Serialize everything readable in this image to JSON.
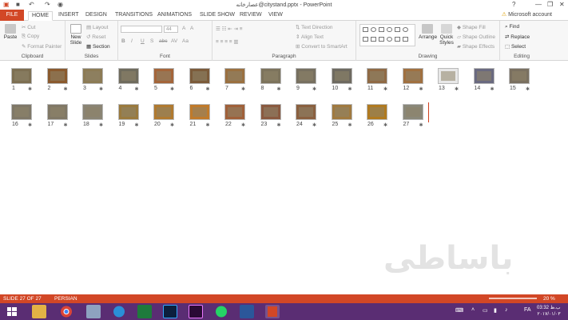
{
  "window": {
    "title": "عصارخانه@citystand.pptx - PowerPoint",
    "help": "?",
    "min": "—",
    "restore": "❐",
    "close": "✕"
  },
  "quick_access": {
    "save": "■",
    "undo": "↶",
    "redo": "↷",
    "start": "◉"
  },
  "tabs": [
    {
      "label": "FILE"
    },
    {
      "label": "HOME"
    },
    {
      "label": "INSERT"
    },
    {
      "label": "DESIGN"
    },
    {
      "label": "TRANSITIONS"
    },
    {
      "label": "ANIMATIONS"
    },
    {
      "label": "SLIDE SHOW"
    },
    {
      "label": "REVIEW"
    },
    {
      "label": "VIEW"
    }
  ],
  "account": {
    "label": "Microsoft account",
    "warning": "⚠"
  },
  "ribbon": {
    "clipboard": {
      "label": "Clipboard",
      "paste": "Paste",
      "cut": "Cut",
      "copy": "Copy",
      "format_painter": "Format Painter"
    },
    "slides": {
      "label": "Slides",
      "new_slide": "New",
      "new_slide2": "Slide",
      "layout": "Layout",
      "reset": "Reset",
      "section": "Section"
    },
    "font": {
      "label": "Font",
      "size": "44",
      "bold": "B",
      "italic": "I",
      "underline": "U",
      "shadow": "S",
      "strike": "abc",
      "spacing": "AV",
      "case": "Aa",
      "grow": "A",
      "shrink": "A"
    },
    "paragraph": {
      "label": "Paragraph",
      "text_direction": "Text Direction",
      "align_text": "Align Text",
      "smartart": "Convert to SmartArt"
    },
    "drawing": {
      "label": "Drawing",
      "arrange": "Arrange",
      "quick_styles": "Quick",
      "quick_styles2": "Styles",
      "shape_fill": "Shape Fill",
      "shape_outline": "Shape Outline",
      "shape_effects": "Shape Effects"
    },
    "editing": {
      "label": "Editing",
      "find": "Find",
      "replace": "Replace",
      "select": "Select"
    }
  },
  "slides": [
    {
      "n": "1"
    },
    {
      "n": "2"
    },
    {
      "n": "3"
    },
    {
      "n": "4"
    },
    {
      "n": "5"
    },
    {
      "n": "6"
    },
    {
      "n": "7"
    },
    {
      "n": "8"
    },
    {
      "n": "9"
    },
    {
      "n": "10"
    },
    {
      "n": "11"
    },
    {
      "n": "12"
    },
    {
      "n": "13"
    },
    {
      "n": "14"
    },
    {
      "n": "15"
    },
    {
      "n": "16"
    },
    {
      "n": "17"
    },
    {
      "n": "18"
    },
    {
      "n": "19"
    },
    {
      "n": "20"
    },
    {
      "n": "21"
    },
    {
      "n": "22"
    },
    {
      "n": "23"
    },
    {
      "n": "24"
    },
    {
      "n": "25"
    },
    {
      "n": "26"
    },
    {
      "n": "27"
    }
  ],
  "star": "✱",
  "watermark": "باساطی",
  "status": {
    "slide": "SLIDE 27 OF 27",
    "lang": "PERSIAN",
    "zoom": "20 %"
  },
  "tray": {
    "lang": "FA",
    "time": "03:32 ب.ظ",
    "date": "۲۰۱۷/۰۱/۰۳"
  }
}
